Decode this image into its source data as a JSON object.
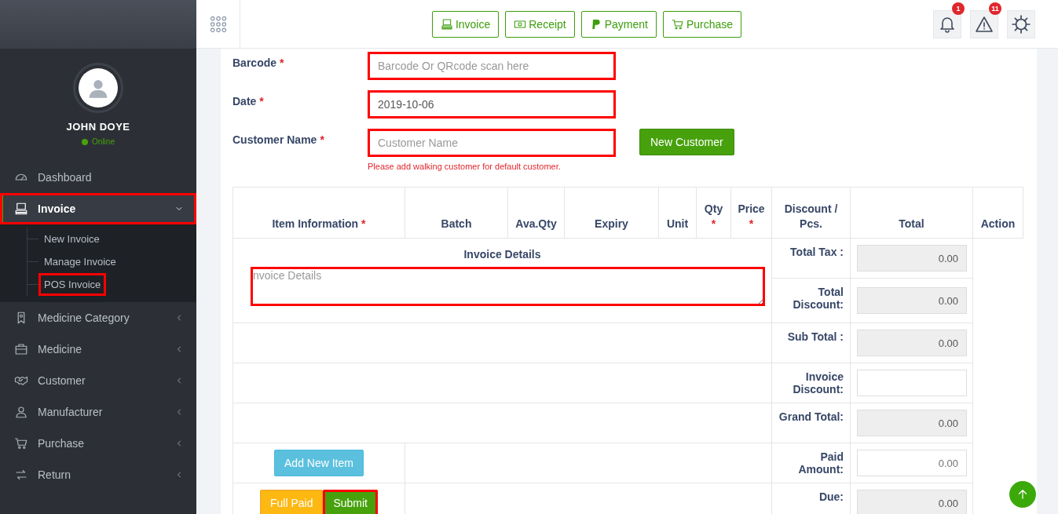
{
  "sidebar": {
    "user": {
      "name": "JOHN DOYE",
      "status": "Online",
      "online": true
    },
    "menu": [
      {
        "kind": "link",
        "label": "Dashboard",
        "selected": false,
        "highlighted": false
      },
      {
        "kind": "group",
        "label": "Invoice",
        "selected": true,
        "expanded": true,
        "highlighted": true,
        "children": [
          {
            "label": "New Invoice",
            "highlighted": false
          },
          {
            "label": "Manage Invoice",
            "highlighted": false
          },
          {
            "label": "POS Invoice",
            "highlighted": true
          }
        ]
      },
      {
        "kind": "group",
        "label": "Medicine Category",
        "selected": false,
        "expanded": false,
        "highlighted": false
      },
      {
        "kind": "group",
        "label": "Medicine",
        "selected": false,
        "expanded": false,
        "highlighted": false
      },
      {
        "kind": "group",
        "label": "Customer",
        "selected": false,
        "expanded": false,
        "highlighted": false
      },
      {
        "kind": "group",
        "label": "Manufacturer",
        "selected": false,
        "expanded": false,
        "highlighted": false
      },
      {
        "kind": "group",
        "label": "Purchase",
        "selected": false,
        "expanded": false,
        "highlighted": false
      },
      {
        "kind": "group",
        "label": "Return",
        "selected": false,
        "expanded": false,
        "highlighted": false
      }
    ]
  },
  "topbar": {
    "shortcuts": [
      "Invoice",
      "Receipt",
      "Payment",
      "Purchase"
    ],
    "alerts": [
      {
        "count": "1"
      },
      {
        "count": "11"
      }
    ]
  },
  "form": {
    "fields": [
      {
        "label": "Barcode",
        "mark": "*",
        "placeholder": "Barcode Or QRcode scan here",
        "highlighted": true
      },
      {
        "label": "Date",
        "mark": "*",
        "value": "2019-10-06",
        "highlighted": true
      },
      {
        "label": "Customer Name",
        "mark": "*",
        "placeholder": "Customer Name",
        "highlighted": true,
        "button": "New Customer",
        "hint": "Please add walking customer for default customer."
      }
    ]
  },
  "table": {
    "columns": [
      {
        "label": "Item Information",
        "mark": "*"
      },
      {
        "label": "Batch"
      },
      {
        "label": "Ava.Qty"
      },
      {
        "label": "Expiry"
      },
      {
        "label": "Unit"
      },
      {
        "label": "Qty",
        "mark": "*"
      },
      {
        "label": "Price",
        "mark": "*"
      },
      {
        "label": "Discount / Pcs."
      },
      {
        "label": "Total"
      },
      {
        "label": "Action"
      }
    ],
    "details": {
      "label": "Invoice Details",
      "placeholder": "nvoice Details",
      "highlighted": true
    },
    "summary": [
      {
        "label": "Total Tax :",
        "value": "0.00",
        "readonly": true
      },
      {
        "label": "Total Discount:",
        "value": "0.00",
        "readonly": true
      },
      {
        "label": "Sub Total :",
        "value": "0.00",
        "readonly": true
      },
      {
        "label": "Invoice Discount:",
        "readonly": false
      },
      {
        "label": "Grand Total:",
        "value": "0.00",
        "readonly": true
      },
      {
        "label": "Paid Amount:",
        "placeholder": "0.00",
        "readonly": false
      },
      {
        "label": "Due:",
        "value": "0.00",
        "readonly": true
      }
    ],
    "buttons": [
      {
        "kind": "add",
        "label": "Add New Item",
        "highlighted": false
      },
      {
        "kind": "full",
        "label": "Full Paid",
        "highlighted": false
      },
      {
        "kind": "submit",
        "label": "Submit",
        "highlighted": true
      }
    ]
  }
}
